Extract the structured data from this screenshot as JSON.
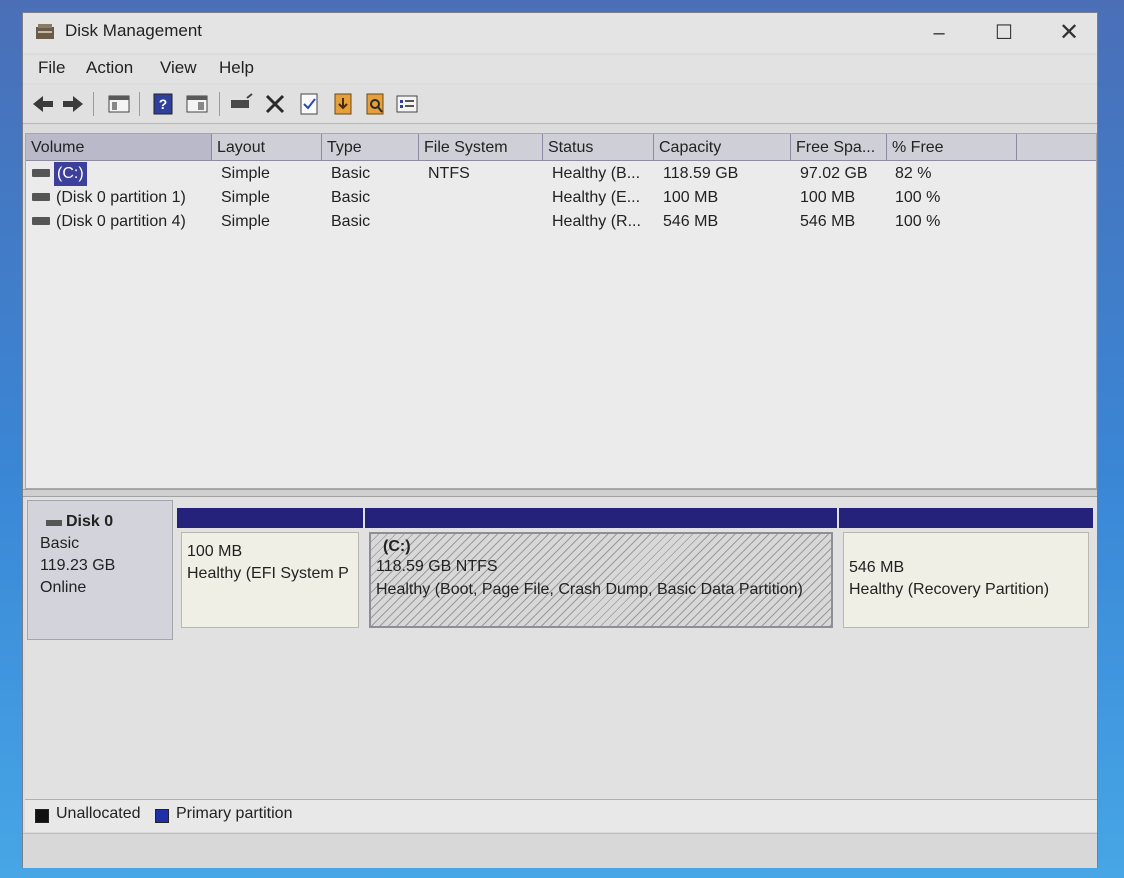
{
  "window": {
    "title": "Disk Management"
  },
  "title_buttons": {
    "minimize": "–",
    "maximize": "☐",
    "close": "✕"
  },
  "menu": [
    "File",
    "Action",
    "View",
    "Help"
  ],
  "toolbar": [
    "back",
    "forward",
    "show-hide-console-tree",
    "help",
    "properties",
    "connect-virtual-disk",
    "delete",
    "check",
    "export-list",
    "find",
    "manage"
  ],
  "volume_table": {
    "columns": [
      "Volume",
      "Layout",
      "Type",
      "File System",
      "Status",
      "Capacity",
      "Free Spa...",
      "% Free"
    ],
    "rows": [
      {
        "volume": "(C:)",
        "layout": "Simple",
        "type": "Basic",
        "file_system": "NTFS",
        "status": "Healthy (B...",
        "capacity": "118.59 GB",
        "free": "97.02 GB",
        "pct_free": "82 %"
      },
      {
        "volume": "(Disk 0 partition 1)",
        "layout": "Simple",
        "type": "Basic",
        "file_system": "",
        "status": "Healthy (E...",
        "capacity": "100 MB",
        "free": "100 MB",
        "pct_free": "100 %"
      },
      {
        "volume": "(Disk 0 partition 4)",
        "layout": "Simple",
        "type": "Basic",
        "file_system": "",
        "status": "Healthy (R...",
        "capacity": "546 MB",
        "free": "546 MB",
        "pct_free": "100 %"
      }
    ]
  },
  "disk": {
    "name": "Disk 0",
    "type": "Basic",
    "size": "119.23 GB",
    "state": "Online",
    "partitions": [
      {
        "label": "",
        "size": "100 MB",
        "status": "Healthy (EFI System P"
      },
      {
        "label": "(C:)",
        "size": "118.59 GB NTFS",
        "status": "Healthy (Boot, Page File, Crash Dump, Basic Data Partition)"
      },
      {
        "label": "",
        "size": "546 MB",
        "status": "Healthy (Recovery Partition)"
      }
    ]
  },
  "legend": [
    {
      "label": "Unallocated",
      "color": "#111111"
    },
    {
      "label": "Primary partition",
      "color": "#1f2fa8"
    }
  ]
}
